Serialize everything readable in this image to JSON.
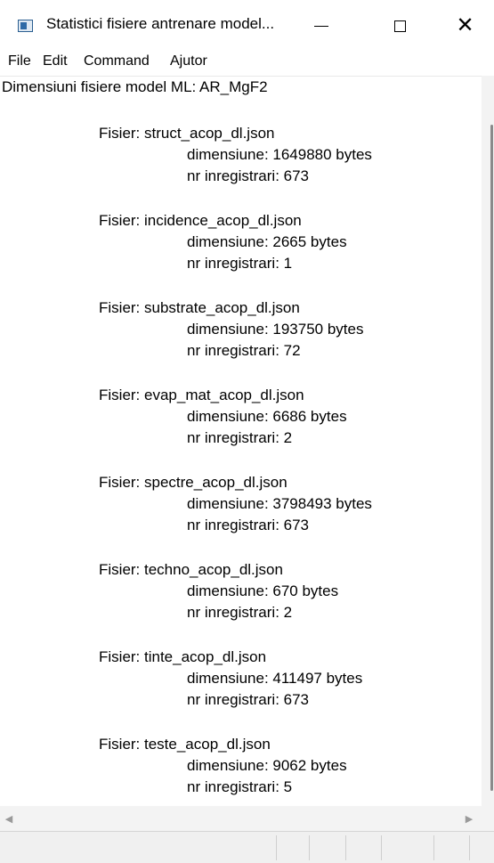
{
  "window": {
    "title": "Statistici fisiere antrenare model...",
    "close_glyph": "✕"
  },
  "menu": [
    "File",
    "Edit",
    "Command",
    "Ajutor"
  ],
  "content": {
    "heading": "Dimensiuni fisiere model ML: AR_MgF2",
    "files": [
      {
        "name": "Fisier: struct_acop_dl.json",
        "size": "dimensiune: 1649880 bytes",
        "records": "nr inregistrari: 673"
      },
      {
        "name": "Fisier: incidence_acop_dl.json",
        "size": "dimensiune: 2665 bytes",
        "records": "nr inregistrari: 1"
      },
      {
        "name": "Fisier: substrate_acop_dl.json",
        "size": "dimensiune: 193750 bytes",
        "records": "nr inregistrari: 72"
      },
      {
        "name": "Fisier: evap_mat_acop_dl.json",
        "size": "dimensiune: 6686 bytes",
        "records": "nr inregistrari: 2"
      },
      {
        "name": "Fisier: spectre_acop_dl.json",
        "size": "dimensiune: 3798493 bytes",
        "records": "nr inregistrari: 673"
      },
      {
        "name": "Fisier: techno_acop_dl.json",
        "size": "dimensiune: 670 bytes",
        "records": "nr inregistrari: 2"
      },
      {
        "name": "Fisier: tinte_acop_dl.json",
        "size": "dimensiune: 411497 bytes",
        "records": "nr inregistrari: 673"
      },
      {
        "name": "Fisier: teste_acop_dl.json",
        "size": "dimensiune: 9062 bytes",
        "records": "nr inregistrari: 5"
      }
    ]
  },
  "scrollbar": {
    "left_arrow": "◀",
    "right_arrow": "▶"
  },
  "icons": {
    "app": "app-window-icon",
    "min": "minimize-icon",
    "max": "maximize-icon",
    "close": "close-icon"
  }
}
